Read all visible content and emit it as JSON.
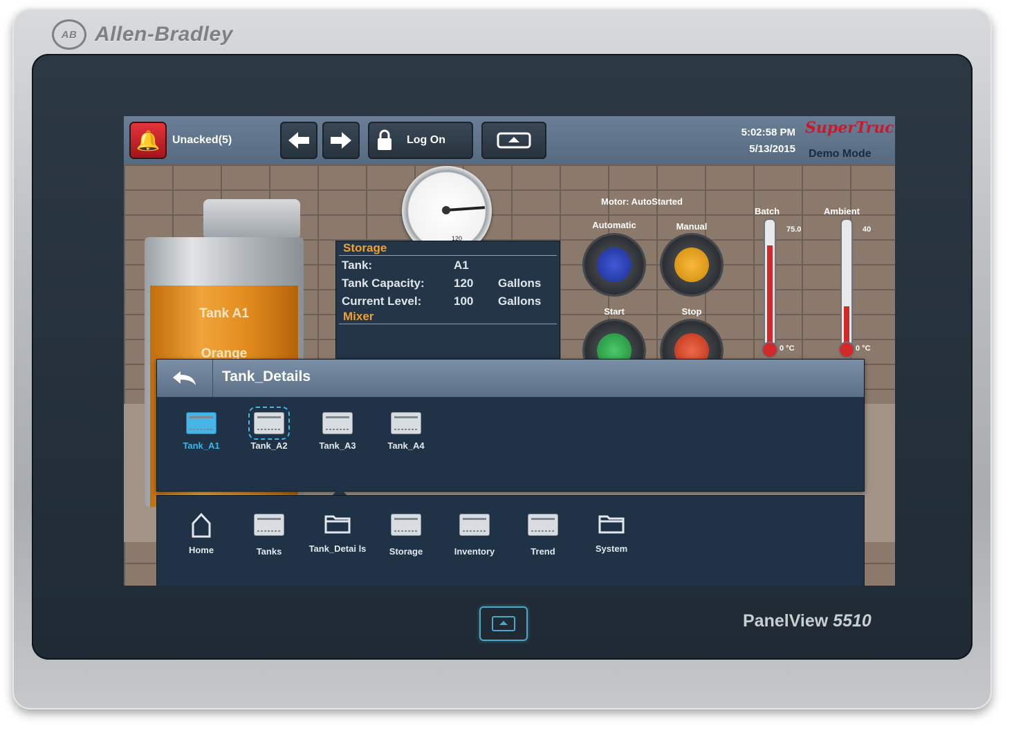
{
  "device": {
    "brand": "Allen-Bradley",
    "brand_mark": "AB",
    "model_prefix": "PanelView",
    "model_number": "5510"
  },
  "topbar": {
    "alarm_label": "Unacked(5)",
    "logon_label": "Log On",
    "time": "5:02:58 PM",
    "date": "5/13/2015",
    "logo_text": "SuperTruck",
    "mode": "Demo Mode"
  },
  "gauge": {
    "scale_max": "120"
  },
  "storage": {
    "header": "Storage",
    "rows": [
      {
        "key": "Tank:",
        "value": "A1",
        "unit": ""
      },
      {
        "key": "Tank Capacity:",
        "value": "120",
        "unit": "Gallons"
      },
      {
        "key": "Current Level:",
        "value": "100",
        "unit": "Gallons"
      }
    ],
    "mixer_header": "Mixer"
  },
  "tank": {
    "label": "Tank A1",
    "product": "Orange"
  },
  "motor": {
    "title": "Motor: AutoStarted",
    "automatic_label": "Automatic",
    "manual_label": "Manual",
    "start_label": "Start",
    "stop_label": "Stop",
    "colors": {
      "automatic": "#2b3fb0",
      "manual": "#f0a214",
      "start": "#2ea84a",
      "stop": "#d8452a"
    }
  },
  "thermometers": [
    {
      "label": "Batch",
      "value": "75.0",
      "min": "0 °C",
      "level": 0.85
    },
    {
      "label": "Ambient",
      "value": "40",
      "min": "0 °C",
      "level": 0.32
    }
  ],
  "tank_details": {
    "title": "Tank_Details",
    "items": [
      {
        "label": "Tank_A1"
      },
      {
        "label": "Tank_A2"
      },
      {
        "label": "Tank_A3"
      },
      {
        "label": "Tank_A4"
      }
    ]
  },
  "nav": {
    "items": [
      {
        "label": "Home"
      },
      {
        "label": "Tanks"
      },
      {
        "label": "Tank_Detai ls"
      },
      {
        "label": "Storage"
      },
      {
        "label": "Inventory"
      },
      {
        "label": "Trend"
      },
      {
        "label": "System"
      }
    ]
  }
}
